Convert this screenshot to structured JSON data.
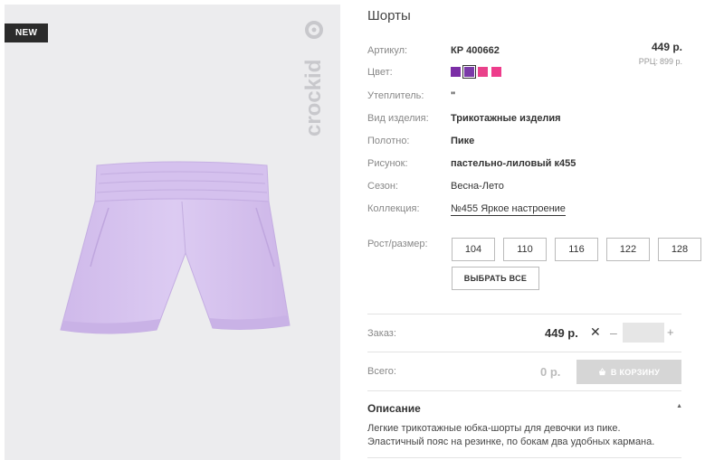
{
  "badge": "NEW",
  "brand": "crockid",
  "product": {
    "title": "Шорты",
    "price": "449 р.",
    "rrp_label": "РРЦ:",
    "rrp_value": "899 р."
  },
  "rows": [
    {
      "label": "Артикул:",
      "value": "КР 400662"
    },
    {
      "label": "Цвет:",
      "value": ""
    },
    {
      "label": "Утеплитель:",
      "value": "\""
    },
    {
      "label": "Вид изделия:",
      "value": "Трикотажные изделия"
    },
    {
      "label": "Полотно:",
      "value": "Пике"
    },
    {
      "label": "Рисунок:",
      "value": "пастельно-лиловый к455"
    },
    {
      "label": "Сезон:",
      "value": "Весна-Лето"
    },
    {
      "label": "Коллекция:",
      "value": "№455 Яркое настроение"
    }
  ],
  "colors": [
    {
      "hex": "#7b2ea6",
      "selected": false
    },
    {
      "hex": "#7a3aa8",
      "selected": true
    },
    {
      "hex": "#e9418a",
      "selected": false
    },
    {
      "hex": "#ee3d8c",
      "selected": false
    }
  ],
  "sizes": {
    "label": "Рост/размер:",
    "options": [
      "104",
      "110",
      "116",
      "122",
      "128"
    ],
    "select_all": "ВЫБРАТЬ ВСЕ"
  },
  "order": {
    "label": "Заказ:",
    "price": "449 р.",
    "times": "✕",
    "minus": "–",
    "plus": "+",
    "quantity": ""
  },
  "total": {
    "label": "Всего:",
    "value": "0 р.",
    "cart_button": "В КОРЗИНУ"
  },
  "description": {
    "title": "Описание",
    "toggle": "▲",
    "text": "Легкие трикотажные юбка-шорты для девочки из пике. Эластичный пояс на резинке, по бокам два удобных кармана."
  },
  "style": {
    "shorts_color": "#d9c6ef",
    "logo_color": "#c8c8cc",
    "panel_bg": "#ececee"
  }
}
